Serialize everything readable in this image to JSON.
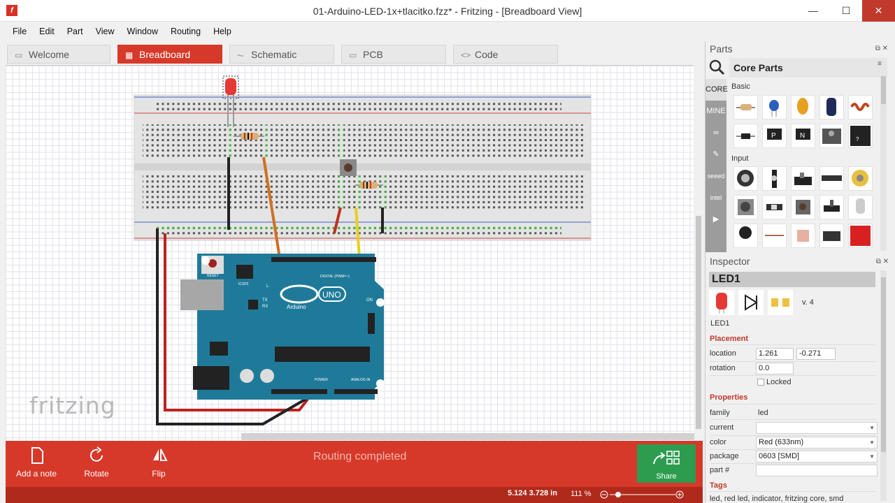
{
  "window": {
    "app_icon": "f",
    "title": "01-Arduino-LED-1x+tlacitko.fzz* - Fritzing - [Breadboard View]",
    "minimize": "—",
    "maximize": "☐",
    "close": "✕"
  },
  "menu": [
    "File",
    "Edit",
    "Part",
    "View",
    "Window",
    "Routing",
    "Help"
  ],
  "tabs": [
    {
      "label": "Welcome",
      "icon": "▭"
    },
    {
      "label": "Breadboard",
      "icon": "▦"
    },
    {
      "label": "Schematic",
      "icon": "⏦"
    },
    {
      "label": "PCB",
      "icon": "▭"
    },
    {
      "label": "Code",
      "icon": "<>"
    }
  ],
  "canvas": {
    "logo": "fritzing",
    "arduino_text": "Arduino",
    "uno_text": "UNO",
    "reset_text": "RESET",
    "icsp_text": "ICSP2",
    "digital_text": "DIGITAL (PWM=~)",
    "power_text": "POWER",
    "analog_text": "ANALOG IN",
    "on_text": "ON",
    "led_l": "L",
    "tx": "TX",
    "rx": "RX"
  },
  "toolbar": {
    "add_note": "Add a note",
    "rotate": "Rotate",
    "flip": "Flip",
    "status": "Routing completed",
    "share": "Share"
  },
  "statusbar": {
    "coords": "5.124 3.728 in",
    "zoom": "111 %",
    "zoom_out": "−",
    "zoom_in": "+"
  },
  "parts": {
    "title": "Parts",
    "bin_title": "Core Parts",
    "bins": [
      "CORE",
      "MINE",
      "∞",
      "✎",
      "seeed",
      "intel",
      "▶"
    ],
    "section_basic": "Basic",
    "section_input": "Input"
  },
  "inspector": {
    "title": "Inspector",
    "part_title": "LED1",
    "part_label": "LED1",
    "version": "v. 4",
    "placement_header": "Placement",
    "location_label": "location",
    "location_x": "1.261",
    "location_y": "-0.271",
    "rotation_label": "rotation",
    "rotation": "0.0",
    "locked_label": "Locked",
    "properties_header": "Properties",
    "family_label": "family",
    "family": "led",
    "current_label": "current",
    "current": "",
    "color_label": "color",
    "color": "Red (633nm)",
    "package_label": "package",
    "package": "0603 [SMD]",
    "partnum_label": "part #",
    "partnum": "",
    "tags_header": "Tags",
    "tags": "led, red led, indicator, fritzing core, smd"
  },
  "colors": {
    "accent": "#d6392a",
    "share": "#2d9c4f",
    "arduino": "#1f7a9a",
    "status_bar": "#b02a1c"
  }
}
